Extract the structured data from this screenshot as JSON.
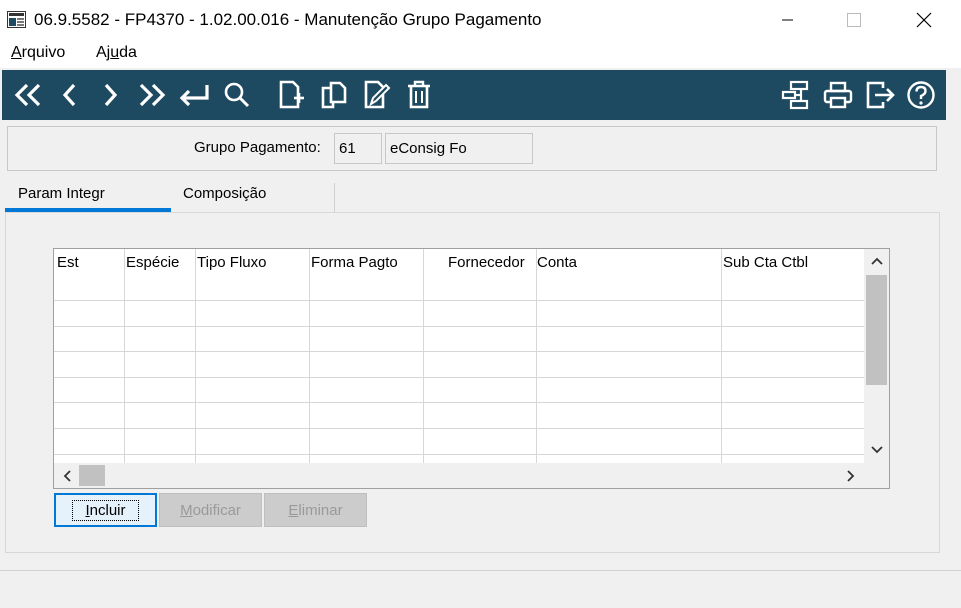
{
  "window": {
    "title": "06.9.5582 - FP4370 - 1.02.00.016 - Manutenção Grupo Pagamento"
  },
  "menu": {
    "items": [
      {
        "label_first": "A",
        "label_rest": "rquivo"
      },
      {
        "label_pre": "Aj",
        "label_u": "u",
        "label_rest": "da"
      }
    ]
  },
  "toolbar": {
    "icons": [
      "first-record",
      "previous-record",
      "next-record",
      "last-record",
      "go-to",
      "search",
      "new-record",
      "copy-record",
      "edit-record",
      "delete-record",
      "hierarchy",
      "print",
      "exit",
      "help"
    ],
    "background": "#1e4a61"
  },
  "header": {
    "grupo_label": "Grupo Pagamento:",
    "grupo_code": "61",
    "grupo_desc": "eConsig Fo"
  },
  "tabs": [
    {
      "label": "Param Integr",
      "active": true
    },
    {
      "label": "Composição",
      "active": false
    }
  ],
  "grid": {
    "columns": [
      "Est",
      "Espécie",
      "Tipo Fluxo",
      "Forma Pagto",
      "Fornecedor",
      "Conta",
      "Sub Cta Ctbl"
    ],
    "rows": []
  },
  "buttons": {
    "incluir_u": "I",
    "incluir_rest": "ncluir",
    "modificar_u": "M",
    "modificar_rest": "odificar",
    "eliminar_u": "E",
    "eliminar_rest": "liminar"
  },
  "colors": {
    "accent": "#0078d7",
    "toolbar": "#1e4a61"
  }
}
